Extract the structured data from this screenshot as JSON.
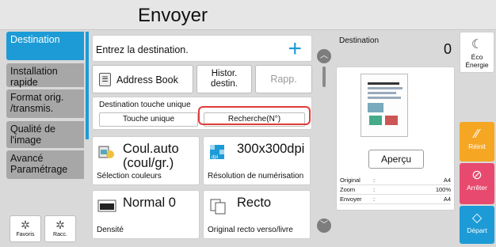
{
  "header": {
    "title": "Envoyer"
  },
  "nav": {
    "items": [
      {
        "label": "Destination",
        "active": true
      },
      {
        "label": "Installation rapide"
      },
      {
        "label": "Format orig. /transmis."
      },
      {
        "label": "Qualité de l'image"
      },
      {
        "label": "Avancé Paramétrage"
      }
    ],
    "favoris_label": "Favoris",
    "racc_label": "Racc."
  },
  "destination": {
    "placeholder": "Entrez la destination.",
    "add_icon": "plus-icon",
    "address_book": "Address Book",
    "histor": "Histor. destin.",
    "rapp": "Rapp.",
    "touche_label": "Destination touche unique",
    "touche_unique": "Touche unique",
    "recherche": "Recherche(N°)"
  },
  "settings": [
    {
      "value": "Coul.auto (coul/gr.)",
      "label": "Sélection couleurs"
    },
    {
      "value": "300x300dpi",
      "label": "Résolution de numérisation"
    },
    {
      "value": "Normal 0",
      "label": "Densité"
    },
    {
      "value": "Recto",
      "label": "Original recto verso/livre"
    }
  ],
  "preview": {
    "destination_label": "Destination",
    "destination_count": "0",
    "apercu": "Aperçu",
    "rows": [
      {
        "key": "Original",
        "sep": ":",
        "value": "A4"
      },
      {
        "key": "Zoom",
        "sep": ":",
        "value": "100%"
      },
      {
        "key": "Envoyer",
        "sep": ":",
        "value": "A4"
      }
    ]
  },
  "side_buttons": {
    "eco": "Éco Énergie",
    "reinit": "Réinit",
    "arreter": "Arrêter",
    "depart": "Départ"
  },
  "colors": {
    "accent": "#1d9bd6",
    "reset": "#f5a623",
    "stop": "#e84a6f",
    "highlight": "#e03c3c"
  }
}
